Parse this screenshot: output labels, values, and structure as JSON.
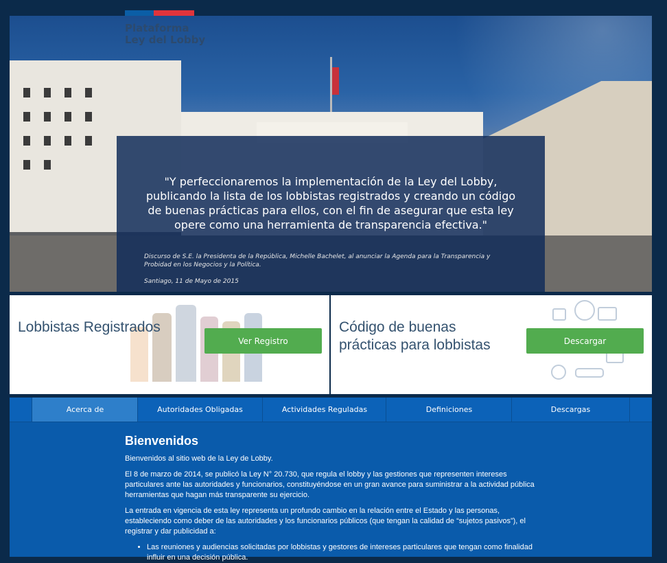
{
  "brand": {
    "line1": "Plataforma",
    "line2": "Ley del Lobby",
    "bar_colors": [
      "#0b5ea6",
      "#e0343c"
    ]
  },
  "hero": {
    "quote": "\"Y perfeccionaremos la implementación de la Ley del Lobby, publicando la lista de los lobbistas registrados y creando un código de buenas prácticas para ellos, con el fin de asegurar que esta ley opere como una herramienta de transparencia efectiva.\"",
    "credit": "Discurso de S.E. la Presidenta de la República, Michelle Bachelet, al anunciar la Agenda para la Transparencia y Probidad en los Negocios y la Política.",
    "place_date": "Santiago, 11 de Mayo de 2015"
  },
  "cards": {
    "registered": {
      "title": "Lobbistas Registrados",
      "button": "Ver Registro"
    },
    "code": {
      "title_line1": "Código de buenas",
      "title_line2": "prácticas para lobbistas",
      "button": "Descargar"
    }
  },
  "nav": {
    "tabs": [
      {
        "label": "Acerca de",
        "active": true
      },
      {
        "label": "Autoridades Obligadas"
      },
      {
        "label": "Actividades Reguladas"
      },
      {
        "label": "Definiciones"
      },
      {
        "label": "Descargas"
      }
    ]
  },
  "content": {
    "heading": "Bienvenidos",
    "p1": "Bienvenidos al sitio web de la Ley de Lobby.",
    "p2": "El 8 de marzo de 2014, se publicó la Ley N° 20.730, que regula el lobby y las gestiones que representen intereses particulares ante las autoridades y funcionarios, constituyéndose en un gran avance para suministrar a la actividad pública herramientas que hagan más transparente su ejercicio.",
    "p3": "La entrada en vigencia de esta ley representa un profundo cambio en la relación entre el Estado y las personas, estableciendo como deber de las autoridades y los funcionarios públicos (que tengan la calidad de “sujetos pasivos”), el registrar y dar publicidad a:",
    "bullet1": "Las reuniones y audiencias solicitadas por lobbistas y gestores de intereses particulares que tengan como finalidad influir en una decisión pública."
  },
  "colors": {
    "accent_green": "#52ac4f",
    "nav_blue": "#0c62b8",
    "content_blue": "#0a5bab",
    "page_bg": "#0b2a4a"
  }
}
